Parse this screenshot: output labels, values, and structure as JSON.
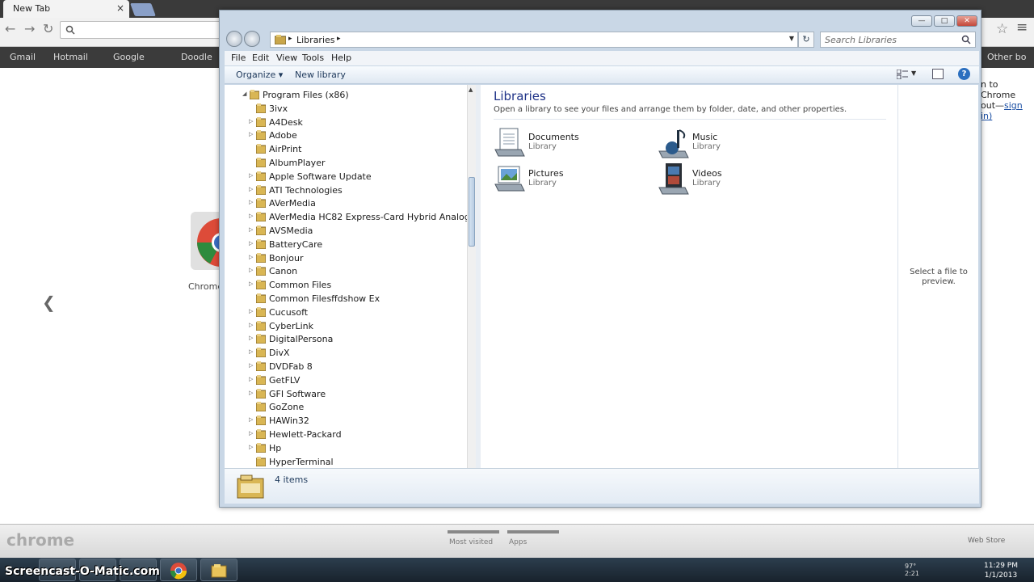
{
  "chrome": {
    "tab_title": "New Tab",
    "tab_close": "×",
    "nav_back": "←",
    "nav_forward": "→",
    "nav_reload": "↻",
    "star": "☆",
    "menu": "≡",
    "bookmarks": [
      "Gmail",
      "Hotmail",
      "Google",
      "Doodle"
    ],
    "bookmarks_right": "Other bo",
    "signin_line1": "n to Chrome",
    "signin_line2_pre": "out—",
    "signin_link": "sign in)",
    "left_arrow": "❮",
    "app_label": "Chrome",
    "bottom_logo": "chrome",
    "most_visited": "Most visited",
    "apps": "Apps",
    "web_store": "Web Store"
  },
  "taskbar": {
    "watermark": "Screencast-O-Matic.com",
    "tray_top": "97°",
    "tray_bottom": "2:21",
    "time": "11:29 PM",
    "date": "1/1/2013"
  },
  "explorer": {
    "titlebar": {
      "minimize": "—",
      "maximize": "□",
      "close": "✕"
    },
    "address": {
      "path": "Libraries",
      "separator": "▸",
      "dropdown": "▼"
    },
    "search": {
      "placeholder": "Search Libraries"
    },
    "menu": [
      "File",
      "Edit",
      "View",
      "Tools",
      "Help"
    ],
    "commands": {
      "organize": "Organize ▾",
      "new_library": "New library"
    },
    "nav": {
      "root": "Program Files (x86)",
      "folders": [
        {
          "label": "3ivx",
          "expandable": false
        },
        {
          "label": "A4Desk",
          "expandable": true
        },
        {
          "label": "Adobe",
          "expandable": true
        },
        {
          "label": "AirPrint",
          "expandable": false
        },
        {
          "label": "AlbumPlayer",
          "expandable": false
        },
        {
          "label": "Apple Software Update",
          "expandable": true
        },
        {
          "label": "ATI Technologies",
          "expandable": true
        },
        {
          "label": "AVerMedia",
          "expandable": true
        },
        {
          "label": "AVerMedia HC82 Express-Card Hybrid Analog",
          "expandable": true
        },
        {
          "label": "AVSMedia",
          "expandable": true
        },
        {
          "label": "BatteryCare",
          "expandable": true
        },
        {
          "label": "Bonjour",
          "expandable": true
        },
        {
          "label": "Canon",
          "expandable": true
        },
        {
          "label": "Common Files",
          "expandable": true
        },
        {
          "label": "Common Filesffdshow Ex",
          "expandable": false
        },
        {
          "label": "Cucusoft",
          "expandable": true
        },
        {
          "label": "CyberLink",
          "expandable": true
        },
        {
          "label": "DigitalPersona",
          "expandable": true
        },
        {
          "label": "DivX",
          "expandable": true
        },
        {
          "label": "DVDFab 8",
          "expandable": true
        },
        {
          "label": "GetFLV",
          "expandable": true
        },
        {
          "label": "GFI Software",
          "expandable": true
        },
        {
          "label": "GoZone",
          "expandable": false
        },
        {
          "label": "HAWin32",
          "expandable": true
        },
        {
          "label": "Hewlett-Packard",
          "expandable": true
        },
        {
          "label": "Hp",
          "expandable": true
        },
        {
          "label": "HyperTerminal",
          "expandable": false
        }
      ]
    },
    "content": {
      "title": "Libraries",
      "subtitle": "Open a library to see your files and arrange them by folder, date, and other properties.",
      "libraries": [
        {
          "name": "Documents",
          "type": "Library",
          "icon": "documents-library-icon"
        },
        {
          "name": "Music",
          "type": "Library",
          "icon": "music-library-icon"
        },
        {
          "name": "Pictures",
          "type": "Library",
          "icon": "pictures-library-icon"
        },
        {
          "name": "Videos",
          "type": "Library",
          "icon": "videos-library-icon"
        }
      ]
    },
    "preview_text": "Select a file to preview.",
    "details": {
      "count": "4 items"
    }
  }
}
